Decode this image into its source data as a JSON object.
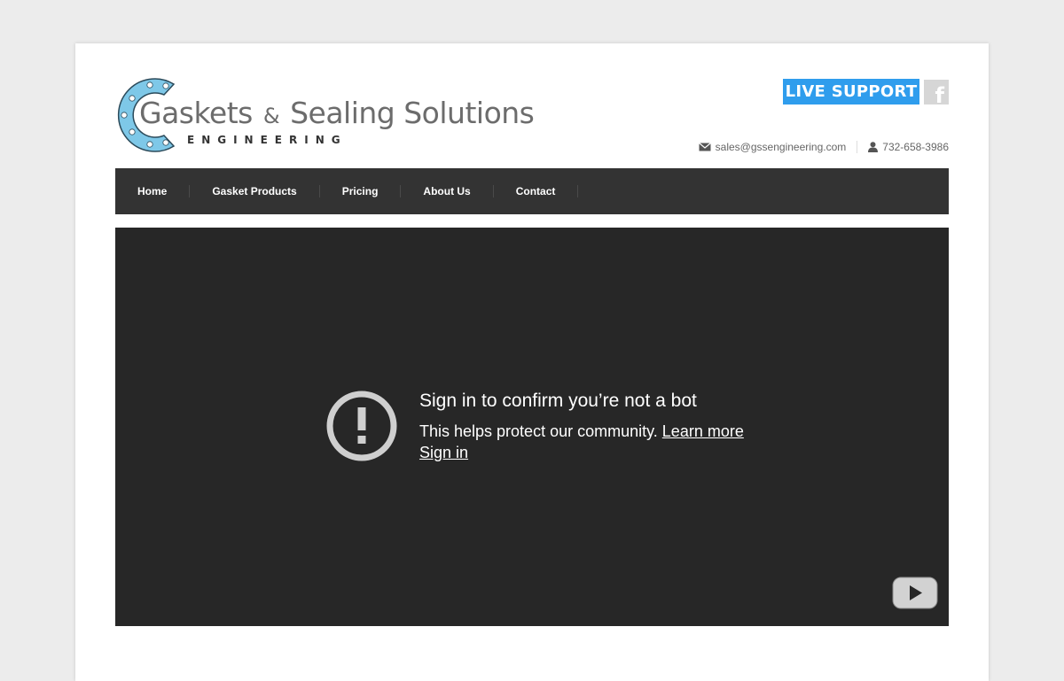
{
  "header": {
    "logo": {
      "title_part1": "Gaskets",
      "title_amp": "&",
      "title_part2": "Sealing Solutions",
      "subtitle": "ENGINEERING"
    },
    "live_support_label": "LIVE SUPPORT",
    "facebook_glyph": "f",
    "email": "sales@gssengineering.com",
    "phone": "732-658-3986"
  },
  "nav": {
    "items": [
      {
        "label": "Home"
      },
      {
        "label": "Gasket Products"
      },
      {
        "label": "Pricing"
      },
      {
        "label": "About Us"
      },
      {
        "label": "Contact"
      }
    ]
  },
  "video": {
    "title": "Sign in to confirm you’re not a bot",
    "message": "This helps protect our community.",
    "learn_more": "Learn more",
    "sign_in": "Sign in"
  },
  "icons": {
    "alert": "exclamation-circle-icon",
    "play": "youtube-play-icon",
    "mail": "envelope-icon",
    "phone": "person-icon"
  },
  "colors": {
    "page_background": "#ececec",
    "accent_blue": "#2f9ded",
    "logo_blue": "#7ec8e8",
    "navbar": "#333333",
    "video_background": "#272727"
  }
}
